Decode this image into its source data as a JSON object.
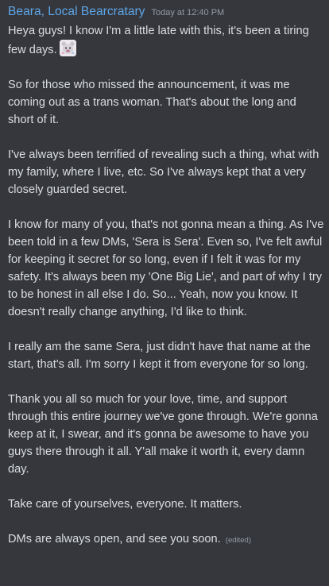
{
  "message": {
    "author": "Beara, Local Bearcratary",
    "timestamp": "Today at 12:40 PM",
    "edited_label": "(edited)",
    "emoji_icon": "sparkly-bear-emoji",
    "paragraphs": [
      "Heya guys! I know I'm a little late with this, it's been a tiring few days.",
      "So for those who missed the announcement, it was me coming out as a trans woman. That's about the long and short of it.",
      "I've always been terrified of revealing such a thing, what with my family, where I live, etc. So I've always kept that a very closely guarded secret.",
      "I know for many of you, that's not gonna mean a thing. As I've been told in a few DMs, 'Sera is Sera'. Even so, I've felt awful for keeping it secret for so long, even if I felt it was for my safety. It's always been my 'One Big Lie', and part of why I try to be honest in all else I do. So... Yeah, now you know. It doesn't really change anything, I'd like to think.",
      "I really am the same Sera, just didn't have that name at the start, that's all. I'm sorry I kept it from everyone for so long.",
      "Thank you all so much for your love, time, and support through this entire journey we've gone through. We're gonna keep at it, I swear, and it's gonna be awesome to have you guys there through it all. Y'all make it worth it, every damn day.",
      "Take care of yourselves, everyone. It matters.",
      "DMs are always open, and see you soon."
    ]
  },
  "colors": {
    "background": "#35373c",
    "username": "#5ea6e8",
    "text": "#dbdee1",
    "muted": "#949ba4"
  }
}
